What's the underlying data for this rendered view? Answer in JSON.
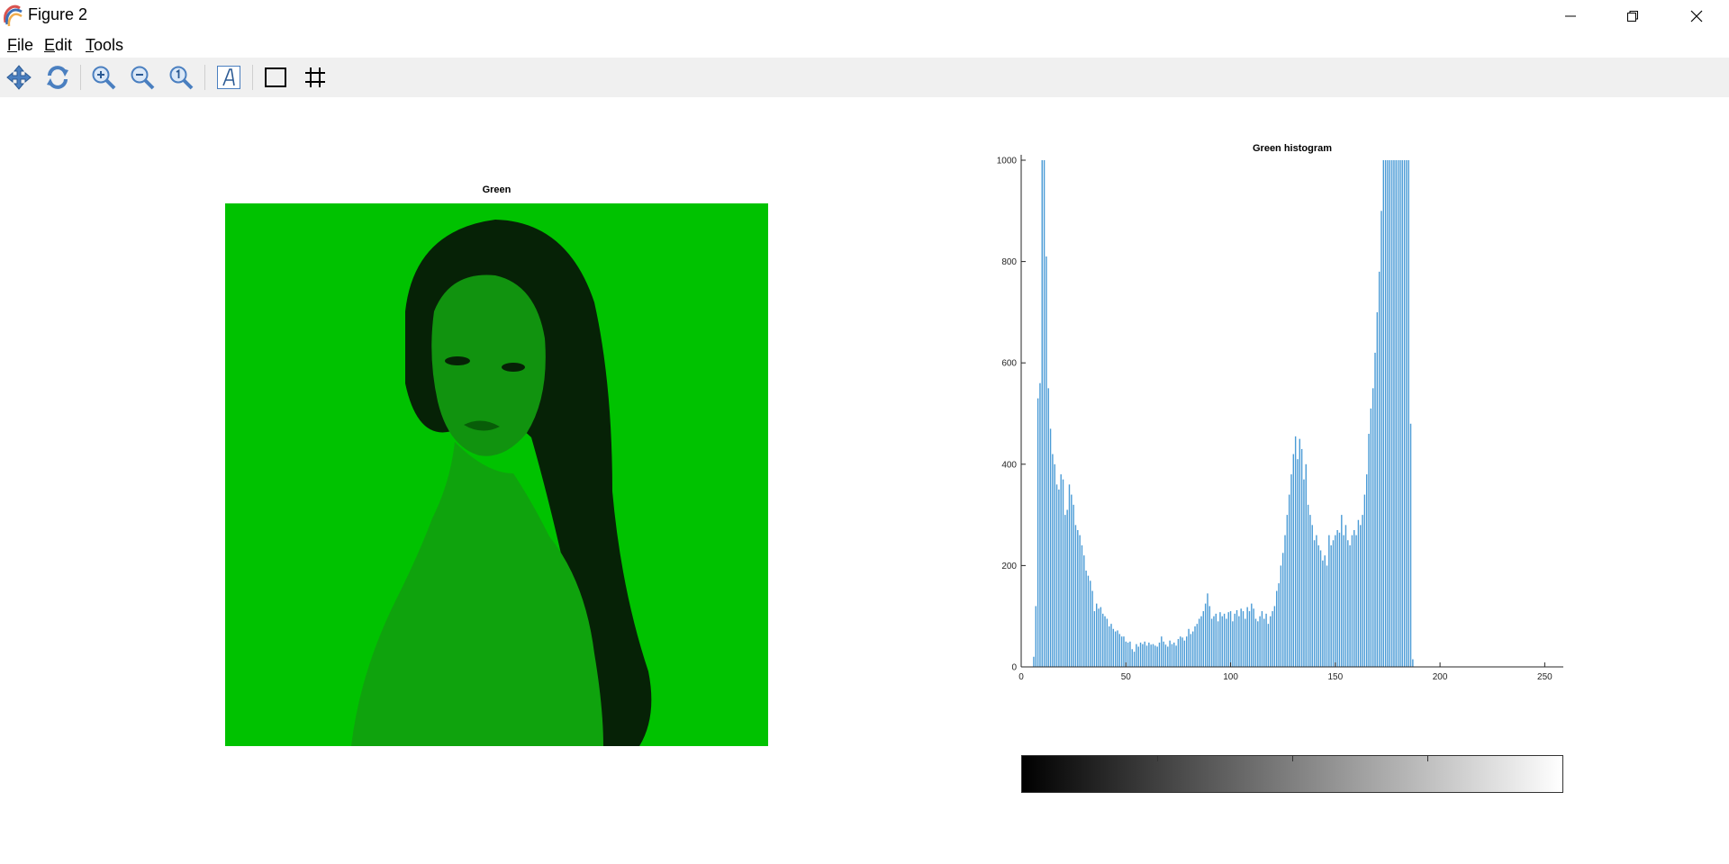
{
  "window": {
    "title": "Figure 2"
  },
  "menu": [
    {
      "accel": "F",
      "rest": "ile"
    },
    {
      "accel": "E",
      "rest": "dit"
    },
    {
      "accel": "T",
      "rest": "ools"
    }
  ],
  "toolbar": {
    "icons": [
      "pan-icon",
      "rotate-icon",
      "zoom-in-icon",
      "zoom-out-icon",
      "zoom-reset-icon",
      "insert-text-icon",
      "toggle-axes-box-icon",
      "toggle-grid-icon"
    ]
  },
  "image_panel": {
    "title": "Green",
    "tint": "#00c200"
  },
  "chart_data": {
    "type": "bar",
    "title": "Green histogram",
    "xlabel": "",
    "ylabel": "",
    "xlim": [
      0,
      255
    ],
    "ylim": [
      0,
      1000
    ],
    "xticks": [
      "0",
      "50",
      "100",
      "150",
      "200",
      "250"
    ],
    "yticks": [
      "0",
      "200",
      "400",
      "600",
      "800",
      "1000"
    ],
    "bar_color": "#4a9bd6",
    "x": [
      0,
      1,
      2,
      3,
      4,
      5,
      6,
      7,
      8,
      9,
      10,
      11,
      12,
      13,
      14,
      15,
      16,
      17,
      18,
      19,
      20,
      21,
      22,
      23,
      24,
      25,
      26,
      27,
      28,
      29,
      30,
      31,
      32,
      33,
      34,
      35,
      36,
      37,
      38,
      39,
      40,
      41,
      42,
      43,
      44,
      45,
      46,
      47,
      48,
      49,
      50,
      51,
      52,
      53,
      54,
      55,
      56,
      57,
      58,
      59,
      60,
      61,
      62,
      63,
      64,
      65,
      66,
      67,
      68,
      69,
      70,
      71,
      72,
      73,
      74,
      75,
      76,
      77,
      78,
      79,
      80,
      81,
      82,
      83,
      84,
      85,
      86,
      87,
      88,
      89,
      90,
      91,
      92,
      93,
      94,
      95,
      96,
      97,
      98,
      99,
      100,
      101,
      102,
      103,
      104,
      105,
      106,
      107,
      108,
      109,
      110,
      111,
      112,
      113,
      114,
      115,
      116,
      117,
      118,
      119,
      120,
      121,
      122,
      123,
      124,
      125,
      126,
      127,
      128,
      129,
      130,
      131,
      132,
      133,
      134,
      135,
      136,
      137,
      138,
      139,
      140,
      141,
      142,
      143,
      144,
      145,
      146,
      147,
      148,
      149,
      150,
      151,
      152,
      153,
      154,
      155,
      156,
      157,
      158,
      159,
      160,
      161,
      162,
      163,
      164,
      165,
      166,
      167,
      168,
      169,
      170,
      171,
      172,
      173,
      174,
      175,
      176,
      177,
      178,
      179,
      180,
      181,
      182,
      183,
      184,
      185,
      186,
      187,
      188,
      189,
      190,
      191,
      192,
      193,
      194,
      195,
      196,
      197,
      198,
      199,
      200,
      201,
      202,
      203,
      204,
      205,
      206,
      207,
      208,
      209,
      210,
      211,
      212,
      213,
      214,
      215,
      216,
      217,
      218,
      219,
      220,
      221,
      222,
      223,
      224,
      225,
      226,
      227,
      228,
      229,
      230,
      231,
      232,
      233,
      234,
      235,
      236,
      237,
      238,
      239,
      240,
      241,
      242,
      243,
      244,
      245,
      246,
      247,
      248,
      249,
      250,
      251,
      252,
      253,
      254,
      255
    ],
    "values": [
      0,
      0,
      0,
      0,
      0,
      0,
      20,
      120,
      530,
      560,
      1000,
      1000,
      810,
      550,
      470,
      420,
      400,
      360,
      350,
      380,
      370,
      300,
      310,
      360,
      340,
      320,
      280,
      270,
      260,
      240,
      220,
      190,
      180,
      170,
      150,
      110,
      125,
      115,
      118,
      105,
      100,
      95,
      80,
      85,
      75,
      70,
      72,
      65,
      60,
      60,
      50,
      48,
      50,
      35,
      30,
      45,
      40,
      48,
      45,
      50,
      42,
      48,
      44,
      45,
      42,
      40,
      48,
      60,
      50,
      44,
      40,
      52,
      45,
      48,
      42,
      55,
      60,
      58,
      52,
      60,
      75,
      65,
      70,
      80,
      85,
      95,
      100,
      110,
      125,
      145,
      120,
      95,
      100,
      105,
      90,
      108,
      100,
      105,
      95,
      108,
      110,
      90,
      105,
      112,
      100,
      115,
      110,
      95,
      118,
      110,
      125,
      115,
      95,
      90,
      100,
      110,
      95,
      105,
      85,
      100,
      110,
      120,
      150,
      165,
      200,
      225,
      260,
      300,
      340,
      380,
      420,
      455,
      410,
      450,
      430,
      370,
      400,
      320,
      300,
      280,
      250,
      260,
      240,
      230,
      210,
      220,
      200,
      260,
      240,
      250,
      260,
      270,
      265,
      300,
      260,
      280,
      250,
      240,
      260,
      270,
      260,
      290,
      280,
      300,
      340,
      380,
      460,
      510,
      550,
      620,
      700,
      780,
      900,
      1000,
      1000,
      1000,
      1000,
      1000,
      1000,
      1000,
      1000,
      1000,
      1000,
      1000,
      1000,
      1000,
      480,
      15,
      0,
      0,
      0,
      0,
      0,
      0,
      0,
      0,
      0,
      0,
      0,
      0,
      0,
      0,
      0,
      0,
      0,
      0,
      0,
      0,
      0,
      0,
      0,
      0,
      0,
      0,
      0,
      0,
      0,
      0,
      0,
      0,
      0,
      0,
      0,
      0,
      0,
      0,
      0,
      0,
      0,
      0,
      0,
      0,
      0,
      0,
      0,
      0,
      0,
      0,
      0,
      0,
      0,
      0,
      0,
      0
    ]
  },
  "colorbar": {
    "from": "#000000",
    "to": "#ffffff",
    "ticks": [
      0.25,
      0.5,
      0.75
    ]
  }
}
